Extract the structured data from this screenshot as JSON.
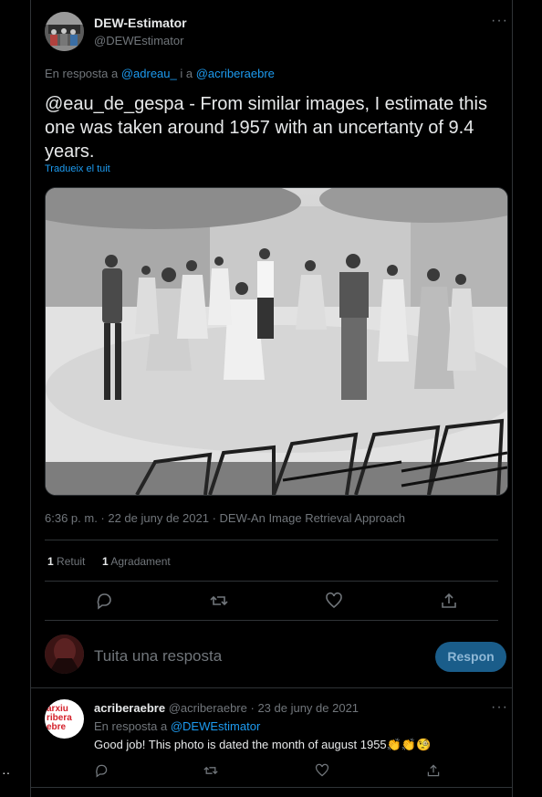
{
  "tweet": {
    "author_name": "DEW-Estimator",
    "author_handle": "@DEWEstimator",
    "reply_prefix": "En resposta a",
    "reply_to_1": "@adreau_",
    "reply_connector": "i a",
    "reply_to_2": "@acriberaebre",
    "text": "@eau_de_gespa - From similar images, I estimate this one was taken around 1957 with an uncertanty of 9.4 years.",
    "translate_label": "Tradueix el tuit",
    "meta": "6:36 p. m. · 22 de juny de 2021 · DEW-An Image Retrieval Approach",
    "retweets_count": "1",
    "retweets_label": "Retuit",
    "likes_count": "1",
    "likes_label": "Agradament",
    "more": "···"
  },
  "compose": {
    "placeholder": "Tuita una resposta",
    "reply_button": "Respon"
  },
  "reply": {
    "author_name": "acriberaebre",
    "author_handle": "@acriberaebre",
    "date": "· 23 de juny de 2021",
    "reply_prefix": "En resposta a",
    "reply_to": "@DEWEstimator",
    "text": "Good job! This photo is dated the month of august 1955👏👏🧐",
    "avatar_text_1": "arxiu",
    "avatar_text_2": "ribera",
    "avatar_text_3": "ebre",
    "more": "···"
  },
  "side": {
    "dots": "··"
  },
  "icons": [
    "reply-icon",
    "retweet-icon",
    "like-icon",
    "share-icon"
  ],
  "colors": {
    "accent": "#1d9bf0",
    "muted": "#71767b",
    "background": "#000000",
    "brand_red": "#d4202a"
  }
}
